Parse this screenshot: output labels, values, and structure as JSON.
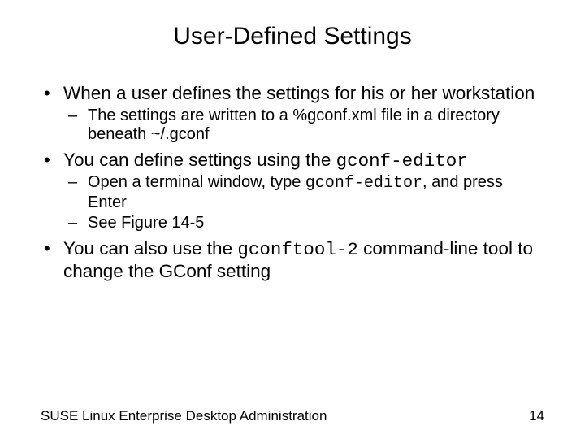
{
  "title": "User-Defined Settings",
  "bullets": {
    "b1": "When a user defines the settings for his or her workstation",
    "b1_1": "The settings are written to a %gconf.xml file in a directory beneath ~/.gconf",
    "b2_pre": "You can define settings using the ",
    "b2_code": "gconf-editor",
    "b2_1_pre": "Open a terminal window, type ",
    "b2_1_code": "gconf-editor",
    "b2_1_post": ", and press Enter",
    "b2_2": "See Figure 14-5",
    "b3_pre": "You can also use the ",
    "b3_code": "gconftool-2",
    "b3_post": " command-line tool to change the GConf setting"
  },
  "footer": {
    "text": "SUSE Linux Enterprise Desktop Administration",
    "page": "14"
  }
}
